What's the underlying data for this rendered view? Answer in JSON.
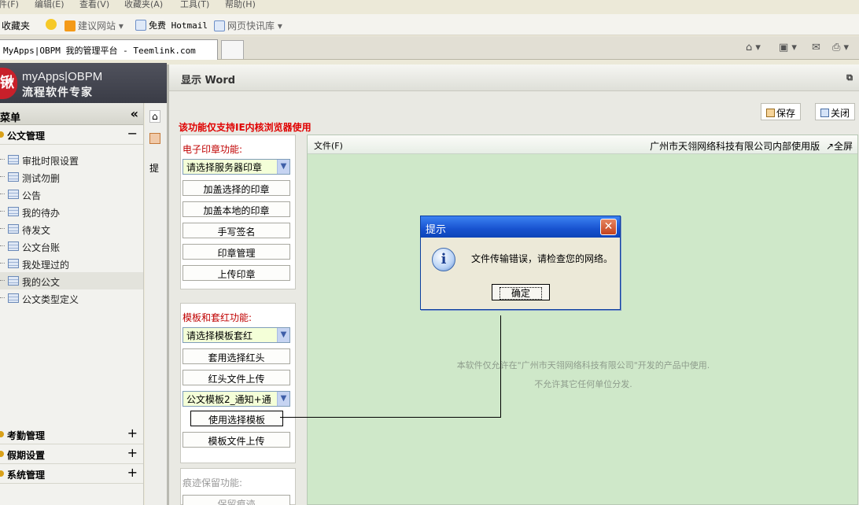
{
  "browser": {
    "menu": [
      "件(F)",
      "编辑(E)",
      "查看(V)",
      "收藏夹(A)",
      "工具(T)",
      "帮助(H)"
    ],
    "favorites_label": "收藏夹",
    "favorites": [
      "建议网站 ▾",
      "免费 Hotmail",
      "网页快讯库 ▾"
    ],
    "tab_title": "MyApps|OBPM 我的管理平台 - Teemlink.com",
    "tools": [
      "⌂ ▾",
      "▣ ▾",
      "✉",
      "⎙ ▾"
    ]
  },
  "app": {
    "logo_badge": "锹",
    "logo_line1": "myApps|OBPM",
    "logo_line2": "流程软件专家"
  },
  "sidebar": {
    "title": "主菜单",
    "collapse": "«",
    "group_open": {
      "label": "公文管理",
      "toggle": "−"
    },
    "items": [
      {
        "label": "审批时限设置"
      },
      {
        "label": "测试勿删"
      },
      {
        "label": "公告"
      },
      {
        "label": "我的待办"
      },
      {
        "label": "待发文"
      },
      {
        "label": "公文台账"
      },
      {
        "label": "我处理过的"
      },
      {
        "label": "我的公文"
      },
      {
        "label": "公文类型定义"
      }
    ],
    "groups_closed": [
      {
        "label": "考勤管理",
        "toggle": "+"
      },
      {
        "label": "假期设置",
        "toggle": "+"
      },
      {
        "label": "系统管理",
        "toggle": "+"
      }
    ]
  },
  "midstrip": {
    "home": "⌂",
    "label": "提"
  },
  "dialog": {
    "title": "显示 Word",
    "save": "保存",
    "close": "关闭",
    "warning": "该功能仅支持IE内核浏览器使用",
    "seal_panel": {
      "title": "电子印章功能:",
      "select": "请选择服务器印章",
      "buttons": [
        "加盖选择的印章",
        "加盖本地的印章",
        "手写签名",
        "印章管理",
        "上传印章"
      ]
    },
    "template_panel": {
      "title": "模板和套红功能:",
      "select1": "请选择模板套红",
      "btn_apply_red": "套用选择红头",
      "btn_upload_red": "红头文件上传",
      "select2": "公文模板2_通知+通",
      "btn_use_template": "使用选择模板",
      "btn_upload_template": "模板文件上传"
    },
    "trace_panel": {
      "title": "痕迹保留功能:",
      "button": "保留痕迹"
    },
    "doc": {
      "menu": "文件(F)",
      "company": "广州市天翎网络科技有限公司内部使用版",
      "fullscreen": "↗全屏",
      "notice1": "本软件仅允许在\"广州市天翎网络科技有限公司\"开发的产品中使用.",
      "notice2": "不允许其它任何单位分发."
    }
  },
  "alert": {
    "title": "提示",
    "message": "文件传输错误，请检查您的网络。",
    "ok": "确定"
  }
}
